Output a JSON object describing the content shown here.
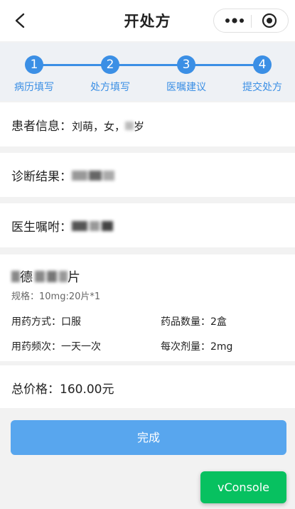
{
  "nav": {
    "title": "开处方"
  },
  "steps": [
    {
      "num": "1",
      "label": "病历填写"
    },
    {
      "num": "2",
      "label": "处方填写"
    },
    {
      "num": "3",
      "label": "医嘱建议"
    },
    {
      "num": "4",
      "label": "提交处方"
    }
  ],
  "patient": {
    "label": "患者信息：",
    "value_prefix": "刘萌，女，",
    "value_suffix": "岁"
  },
  "diagnosis": {
    "label": "诊断结果："
  },
  "advice": {
    "label": "医生嘱咐："
  },
  "drug": {
    "name_visible": "德",
    "name_end": "片",
    "spec_label": "规格：",
    "spec_value": "10mg:20片*1",
    "method_label": "用药方式：",
    "method_value": "口服",
    "qty_label": "药品数量：",
    "qty_value": "2盒",
    "freq_label": "用药频次：",
    "freq_value": "一天一次",
    "dose_label": "每次剂量：",
    "dose_value": "2mg"
  },
  "total": {
    "label": "总价格：",
    "value": "160.00元"
  },
  "buttons": {
    "done": "完成",
    "vconsole": "vConsole"
  },
  "colors": {
    "accent": "#3b8fe5",
    "button": "#58a6ee",
    "vconsole": "#07c160"
  }
}
